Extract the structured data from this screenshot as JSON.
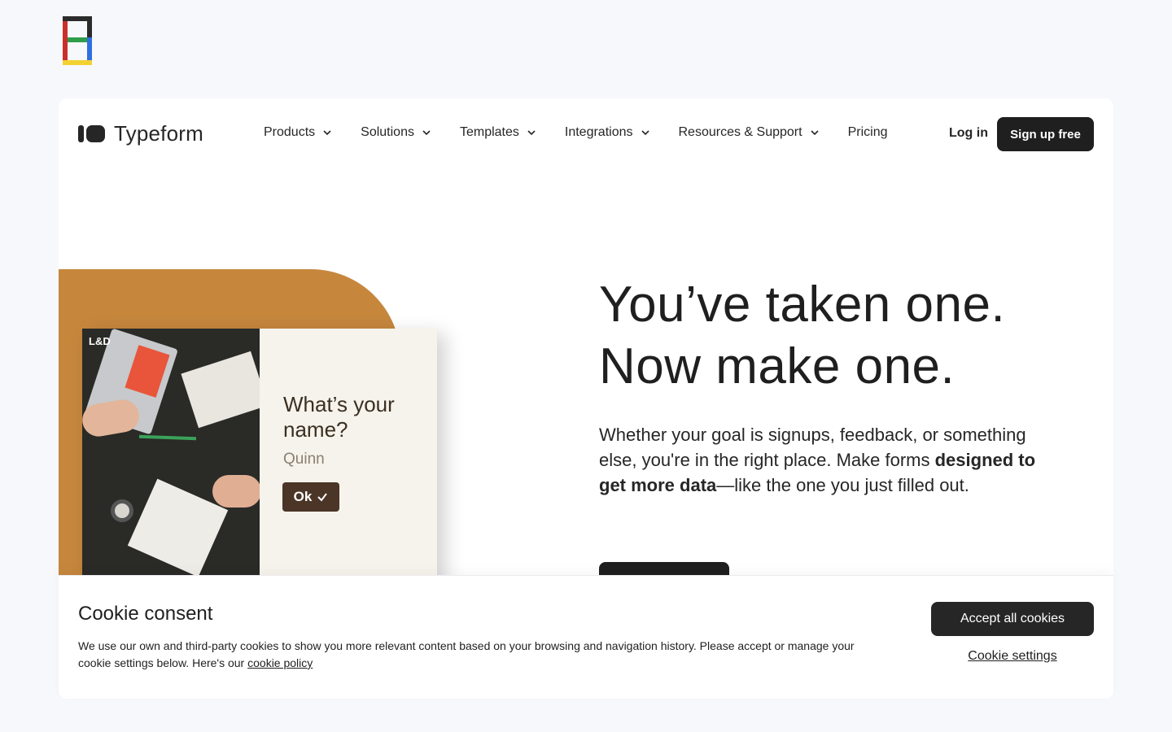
{
  "brand": {
    "name": "Typeform"
  },
  "nav": {
    "items": [
      {
        "label": "Products",
        "has_dropdown": true
      },
      {
        "label": "Solutions",
        "has_dropdown": true
      },
      {
        "label": "Templates",
        "has_dropdown": true
      },
      {
        "label": "Integrations",
        "has_dropdown": true
      },
      {
        "label": "Resources & Support",
        "has_dropdown": true
      },
      {
        "label": "Pricing",
        "has_dropdown": false
      }
    ],
    "login_label": "Log in",
    "signup_label": "Sign up free"
  },
  "hero": {
    "headline_line1": "You’ve taken one.",
    "headline_line2": "Now make one.",
    "sub_before": "Whether your goal is signups, feedback, or something else, you're in the right place. Make forms ",
    "sub_bold": "designed to get more data",
    "sub_after": "—like the one you just filled out."
  },
  "preview": {
    "badge": "L&D",
    "question": "What’s your name?",
    "answer": "Quinn",
    "ok_label": "Ok"
  },
  "cookie": {
    "title": "Cookie consent",
    "body": "We use our own and third-party cookies to show you more relevant content based on your browsing and navigation history. Please accept or manage your cookie settings below. Here's our ",
    "policy_link": "cookie policy",
    "accept_label": "Accept all cookies",
    "settings_label": "Cookie settings"
  },
  "colors": {
    "page_bg": "#f7f8fb",
    "accent_dark": "#1f1f1f",
    "hero_orange": "#c6873d",
    "ok_button": "#4b3526"
  }
}
